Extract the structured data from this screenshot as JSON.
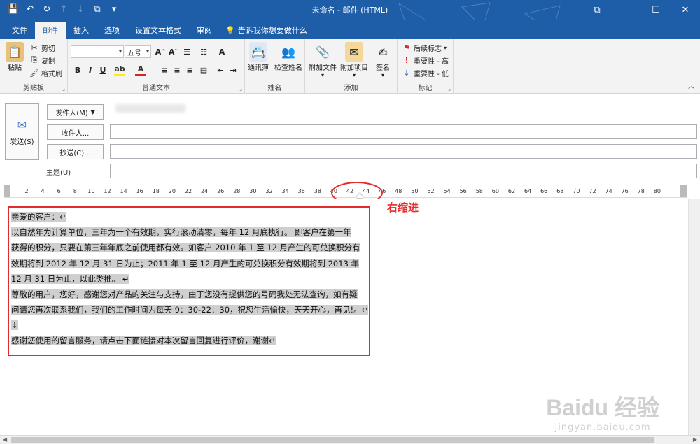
{
  "window": {
    "title": "未命名 - 邮件 (HTML)",
    "controls": [
      "restore-icon",
      "minimize-icon",
      "maximize-icon",
      "close-icon"
    ]
  },
  "quick_access": [
    "save-icon",
    "undo-icon",
    "redo-icon",
    "up-arrow-icon",
    "down-arrow-icon",
    "customize-icon"
  ],
  "tabs": [
    {
      "label": "文件"
    },
    {
      "label": "邮件"
    },
    {
      "label": "插入"
    },
    {
      "label": "选项"
    },
    {
      "label": "设置文本格式"
    },
    {
      "label": "审阅"
    }
  ],
  "tell_me": "告诉我你想要做什么",
  "ribbon": {
    "clipboard": {
      "label": "剪贴板",
      "paste": "粘贴",
      "cut": "剪切",
      "copy": "复制",
      "format_painter": "格式刷"
    },
    "basic_text": {
      "label": "普通文本",
      "font_value": "",
      "size_value": "五号"
    },
    "names": {
      "label": "姓名",
      "address_book": "通讯簿",
      "check_names": "检查姓名"
    },
    "include": {
      "label": "添加",
      "attach_file": "附加文件",
      "attach_item": "附加项目",
      "signature": "签名"
    },
    "tags": {
      "label": "标记",
      "follow_up": "后续标志",
      "high_importance": "重要性 - 高",
      "low_importance": "重要性 - 低"
    }
  },
  "header": {
    "send": "发送(S)",
    "from": "发件人(M)",
    "to": "收件人...",
    "cc": "抄送(C)...",
    "subject": "主题(U)"
  },
  "ruler": {
    "ticks": [
      "2",
      "4",
      "6",
      "8",
      "10",
      "12",
      "14",
      "16",
      "18",
      "20",
      "22",
      "24",
      "26",
      "28",
      "30",
      "32",
      "34",
      "36",
      "38",
      "40",
      "42",
      "44",
      "46",
      "48",
      "50",
      "52",
      "54",
      "56",
      "58",
      "60",
      "62",
      "64",
      "66",
      "68",
      "70",
      "72",
      "74",
      "76",
      "78",
      "80"
    ]
  },
  "annotation": "右缩进",
  "body": {
    "lines": [
      "亲爱的客户：↵",
      "以自然年为计算单位，三年为一个有效期，实行滚动清零，每年 12 月底执行。 即客户在第一年",
      "获得的积分，只要在第三年年底之前使用都有效。如客户 2010 年 1 至 12 月产生的可兑换积分有",
      "效期将到 2012 年 12 月 31 日为止；2011 年 1 至 12 月产生的可兑换积分有效期将到 2013 年",
      "12 月 31 日为止，以此类推。 ↵",
      "尊敬的用户，您好，感谢您对产品的关注与支持，由于您没有提供您的号码我处无法查询，如有疑",
      "问请您再次联系我们，我们的工作时间为每天 9：30-22：30，祝您生活愉快，天天开心，再见!。↵",
      "↓",
      "感谢您使用的留言服务，请点击下面链接对本次留言回复进行评价，谢谢↵"
    ]
  },
  "watermark": {
    "brand": "Baidu 经验",
    "url": "jingyan.baidu.com"
  }
}
